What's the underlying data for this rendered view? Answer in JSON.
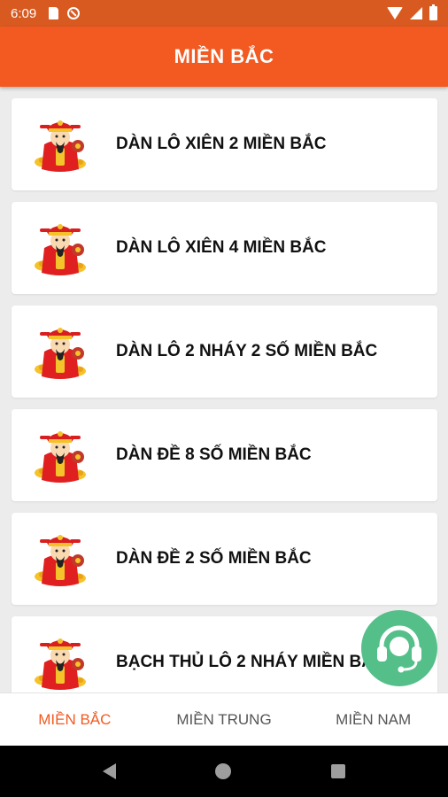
{
  "status_bar": {
    "time": "6:09"
  },
  "app_bar": {
    "title": "MIỀN BẮC"
  },
  "list": {
    "items": [
      {
        "label": "DÀN LÔ XIÊN 2 MIỀN BẮC"
      },
      {
        "label": "DÀN LÔ XIÊN 4 MIỀN BẮC"
      },
      {
        "label": "DÀN LÔ 2 NHÁY 2 SỐ MIỀN BẮC"
      },
      {
        "label": "DÀN ĐỀ 8 SỐ MIỀN BẮC"
      },
      {
        "label": "DÀN ĐỀ 2 SỐ MIỀN BẮC"
      },
      {
        "label": "BẠCH THỦ LÔ 2 NHÁY MIỀN BẮC"
      }
    ],
    "item_icon": "god-of-wealth-icon"
  },
  "fab": {
    "icon": "headset-support-icon",
    "color": "#55bf8a"
  },
  "bottom_nav": {
    "tabs": [
      {
        "label": "MIỀN BẮC",
        "active": true
      },
      {
        "label": "MIỀN TRUNG",
        "active": false
      },
      {
        "label": "MIỀN NAM",
        "active": false
      }
    ]
  },
  "colors": {
    "primary": "#f25a22",
    "status_bar": "#d85a21",
    "background": "#ececec"
  }
}
